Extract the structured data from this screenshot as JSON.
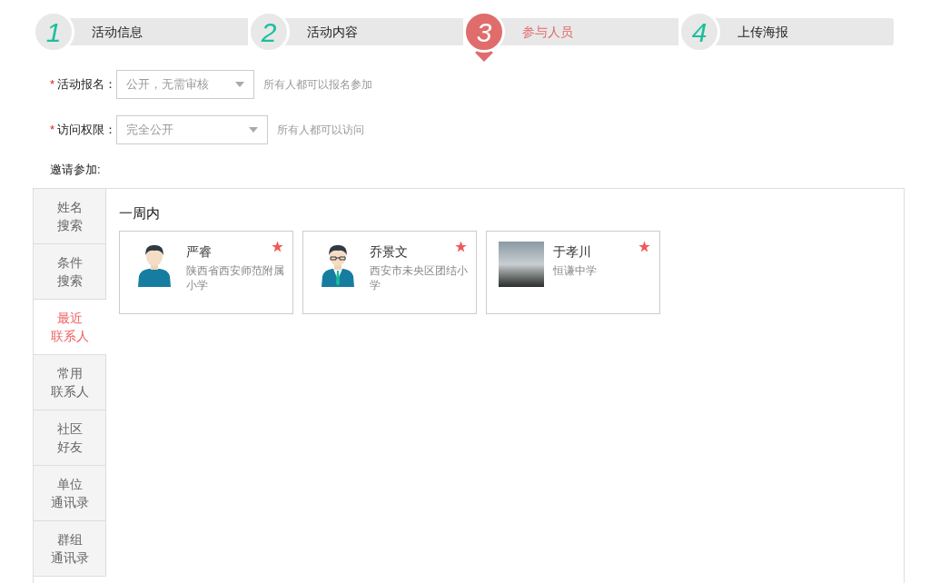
{
  "steps": [
    {
      "number": "1",
      "label": "活动信息",
      "selected": false
    },
    {
      "number": "2",
      "label": "活动内容",
      "selected": false
    },
    {
      "number": "3",
      "label": "参与人员",
      "selected": true
    },
    {
      "number": "4",
      "label": "上传海报",
      "selected": false
    }
  ],
  "form": [
    {
      "required_mark": "*",
      "label": "活动报名：",
      "value": "公开，无需审核",
      "hint": "所有人都可以报名参加"
    },
    {
      "required_mark": "*",
      "label": "访问权限：",
      "value": "完全公开",
      "hint": "所有人都可以访问"
    }
  ],
  "invite_label": "邀请参加:",
  "side_tabs": [
    {
      "lines": [
        "姓名",
        "搜索"
      ],
      "selected": false
    },
    {
      "lines": [
        "条件",
        "搜索"
      ],
      "selected": false
    },
    {
      "lines": [
        "最近",
        "联系人"
      ],
      "selected": true
    },
    {
      "lines": [
        "常用",
        "联系人"
      ],
      "selected": false
    },
    {
      "lines": [
        "社区",
        "好友"
      ],
      "selected": false
    },
    {
      "lines": [
        "单位",
        "通讯录"
      ],
      "selected": false
    },
    {
      "lines": [
        "群组",
        "通讯录"
      ],
      "selected": false
    }
  ],
  "section_title": "一周内",
  "contacts": [
    {
      "kind": "male",
      "name": "严睿",
      "org": "陕西省西安师范附属小学",
      "starred": true
    },
    {
      "kind": "male-glasses",
      "name": "乔景文",
      "org": "西安市未央区团结小学",
      "starred": true
    },
    {
      "kind": "photo",
      "name": "于孝川",
      "org": "恒谦中学",
      "starred": true
    }
  ]
}
